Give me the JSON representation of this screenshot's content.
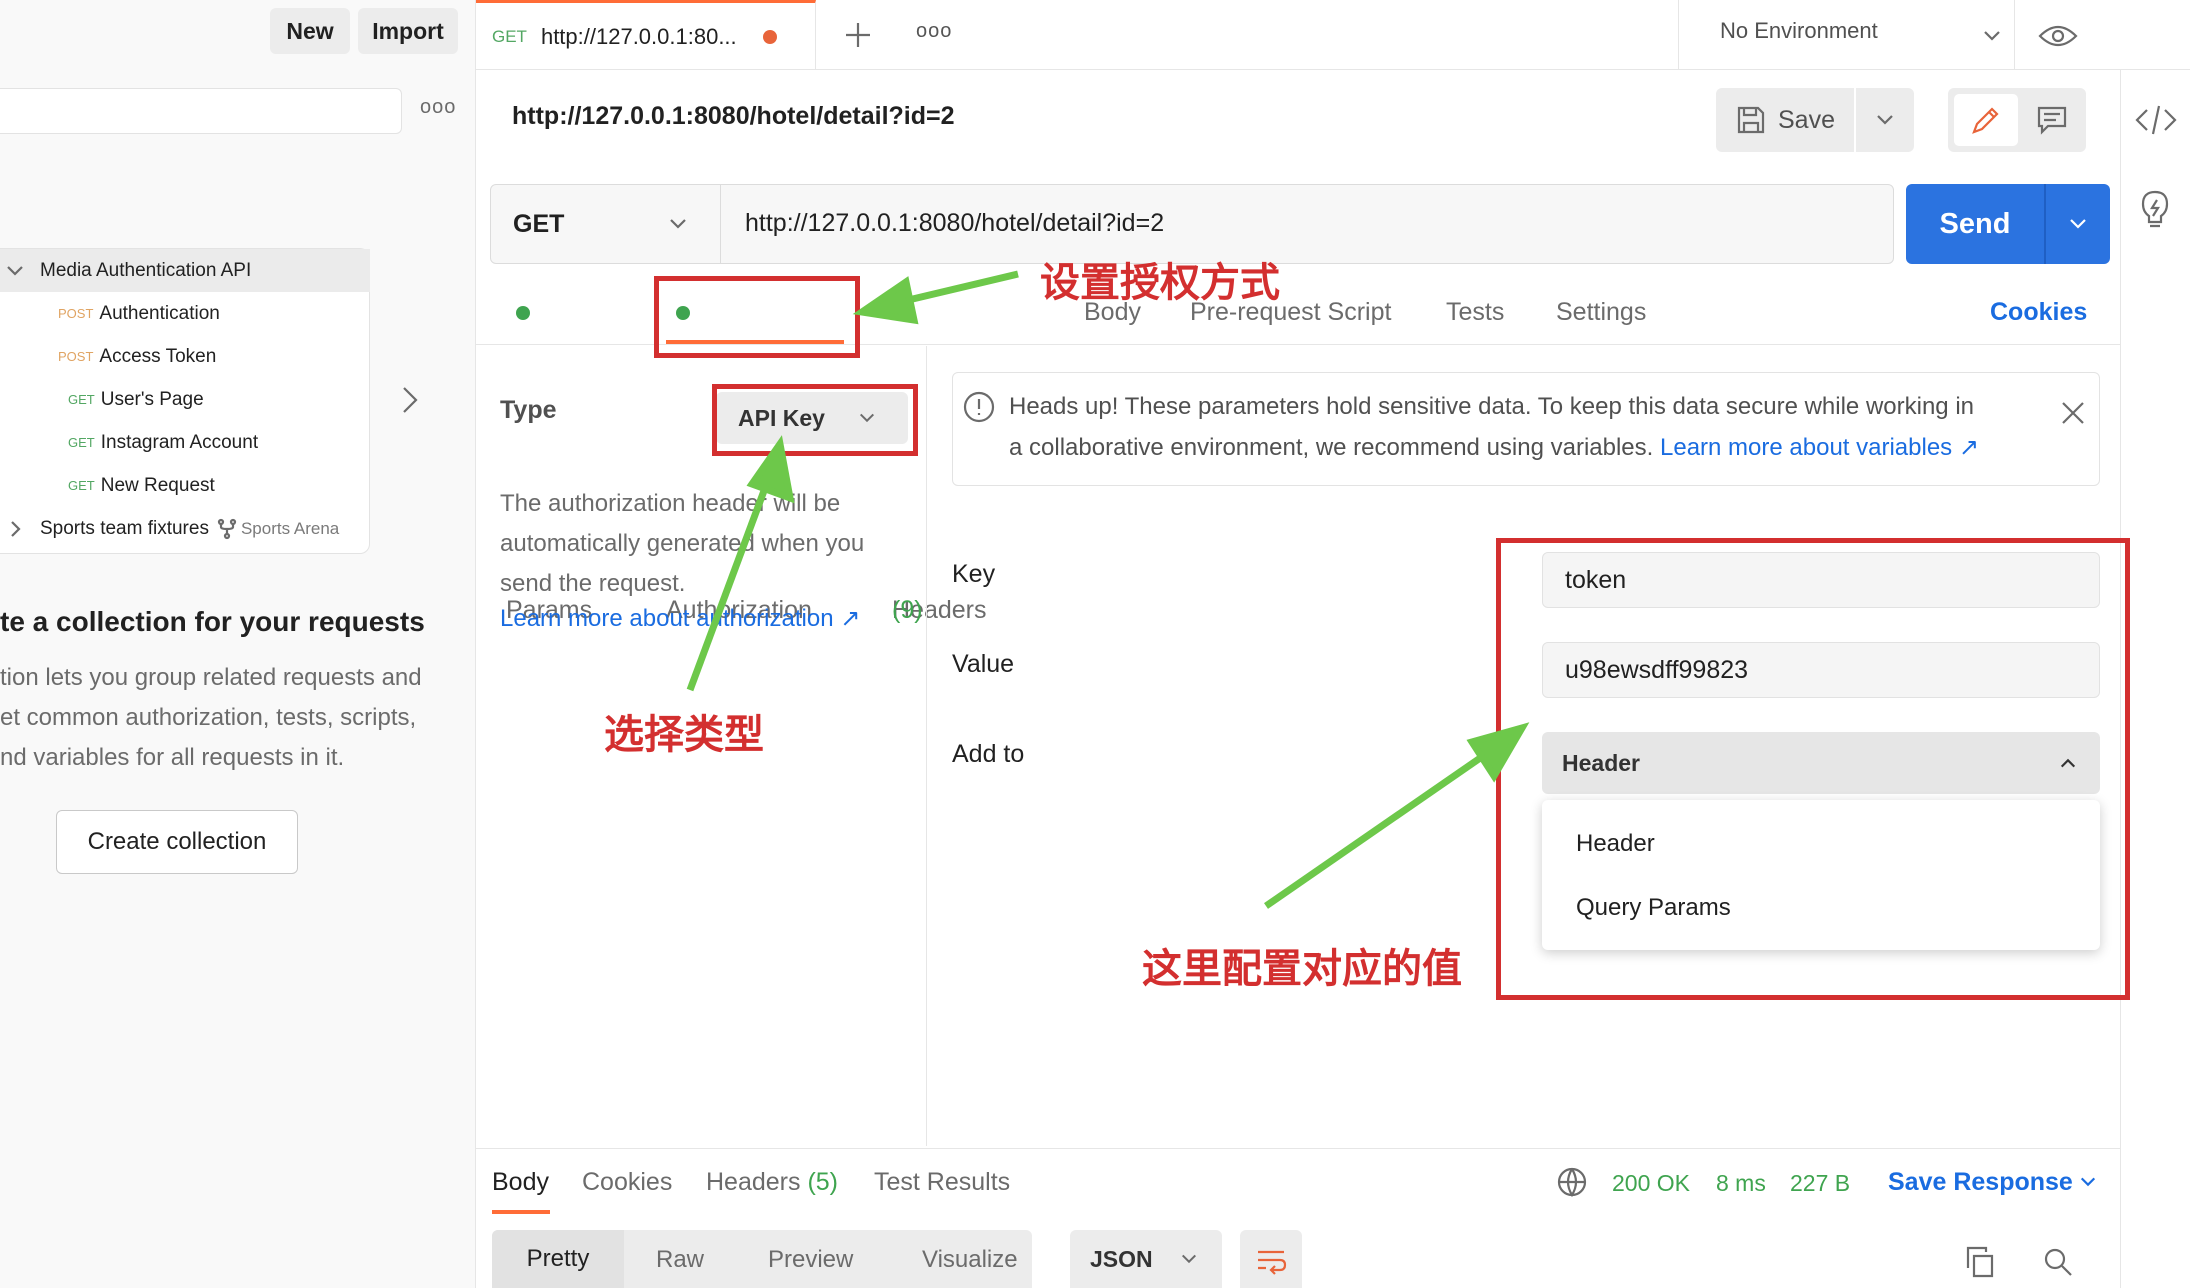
{
  "sidebar": {
    "new_label": "New",
    "import_label": "Import",
    "more": "ooo",
    "tree": [
      {
        "label": "Media Authentication API",
        "kind": "collection"
      },
      {
        "method": "POST",
        "label": "Authentication"
      },
      {
        "method": "POST",
        "label": "Access Token"
      },
      {
        "method": "GET",
        "label": "User's Page"
      },
      {
        "method": "GET",
        "label": "Instagram Account"
      },
      {
        "method": "GET",
        "label": "New Request"
      },
      {
        "label": "Sports team fixtures",
        "kind": "collection",
        "fork": "Sports Arena"
      }
    ],
    "create_heading": "te a collection for your requests",
    "create_text": [
      "tion lets you group related requests and",
      "et common authorization, tests, scripts,",
      "nd variables for all requests in it."
    ],
    "create_button": "Create collection"
  },
  "tabbar": {
    "tab_method": "GET",
    "tab_title": "http://127.0.0.1:80...",
    "more": "ooo",
    "environment": "No Environment"
  },
  "request": {
    "title": "http://127.0.0.1:8080/hotel/detail?id=2",
    "save_label": "Save",
    "method": "GET",
    "url": "http://127.0.0.1:8080/hotel/detail?id=2",
    "send_label": "Send",
    "tabs": {
      "params": "Params",
      "authorization": "Authorization",
      "headers": "Headers",
      "headers_count": "(9)",
      "body": "Body",
      "prerequest": "Pre-request Script",
      "tests": "Tests",
      "settings": "Settings",
      "cookies": "Cookies"
    }
  },
  "auth": {
    "type_label": "Type",
    "type_value": "API Key",
    "desc": [
      "The authorization header will be",
      "automatically generated when you",
      "send the request."
    ],
    "learn_link": "Learn more about authorization ↗",
    "notice": "Heads up! These parameters hold sensitive data. To keep this data secure while working in",
    "notice2": "a collaborative environment, we recommend using variables. ",
    "notice_link": "Learn more about variables ↗",
    "key_label": "Key",
    "key_value": "token",
    "value_label": "Value",
    "value_value": "u98ewsdff99823",
    "addto_label": "Add to",
    "addto_value": "Header",
    "options": [
      "Header",
      "Query Params"
    ]
  },
  "annotations": {
    "set_auth": "设置授权方式",
    "choose_type": "选择类型",
    "config_values": "这里配置对应的值"
  },
  "response": {
    "tabs": {
      "body": "Body",
      "cookies": "Cookies",
      "headers": "Headers",
      "headers_count": "(5)",
      "tests": "Test Results"
    },
    "status": "200 OK",
    "time": "8 ms",
    "size": "227 B",
    "save": "Save Response",
    "views": [
      "Pretty",
      "Raw",
      "Preview",
      "Visualize"
    ],
    "format": "JSON"
  },
  "colors": {
    "accent": "#1a6ce0",
    "send": "#2b73e0",
    "annotation": "#d32f2f",
    "arrow": "#6dc84a",
    "get": "#53a763",
    "post": "#e0a463",
    "dot_orange": "#e8643a"
  }
}
